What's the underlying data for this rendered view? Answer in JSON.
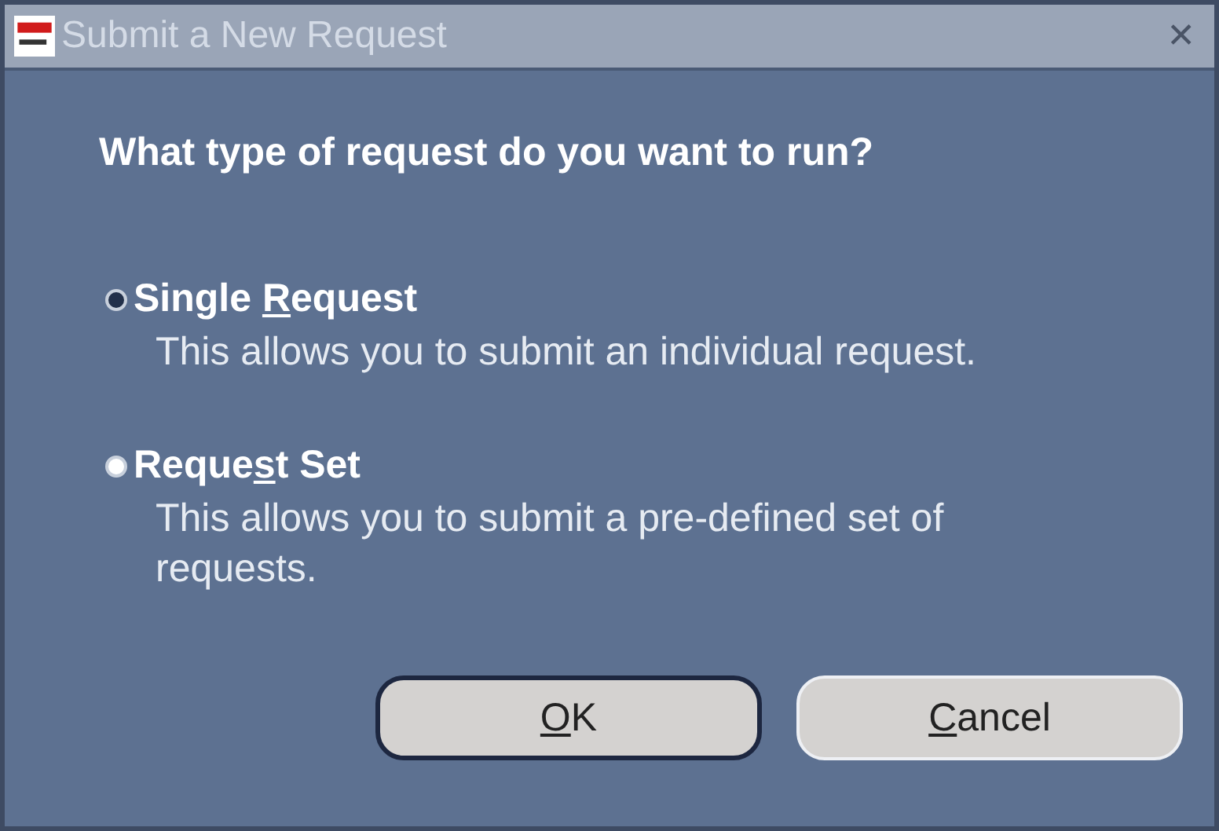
{
  "window": {
    "title": "Submit a New Request",
    "close": "✕"
  },
  "question": "What type of request do you want to run?",
  "options": [
    {
      "label": [
        {
          "text": "Single ",
          "underlined": false
        },
        {
          "text": "R",
          "underlined": true
        },
        {
          "text": "equest",
          "underlined": false
        }
      ],
      "description": "This allows you to submit an individual request.",
      "selected": true
    },
    {
      "label": [
        {
          "text": "Reque",
          "underlined": false
        },
        {
          "text": "s",
          "underlined": true
        },
        {
          "text": "t Set",
          "underlined": false
        }
      ],
      "description": "This allows you to submit a pre-defined set of requests.",
      "selected": false
    }
  ],
  "buttons": [
    {
      "label": [
        {
          "text": "O",
          "underlined": true
        },
        {
          "text": "K",
          "underlined": false
        }
      ],
      "default": true
    },
    {
      "label": [
        {
          "text": "C",
          "underlined": true
        },
        {
          "text": "ancel",
          "underlined": false
        }
      ],
      "default": false
    }
  ]
}
